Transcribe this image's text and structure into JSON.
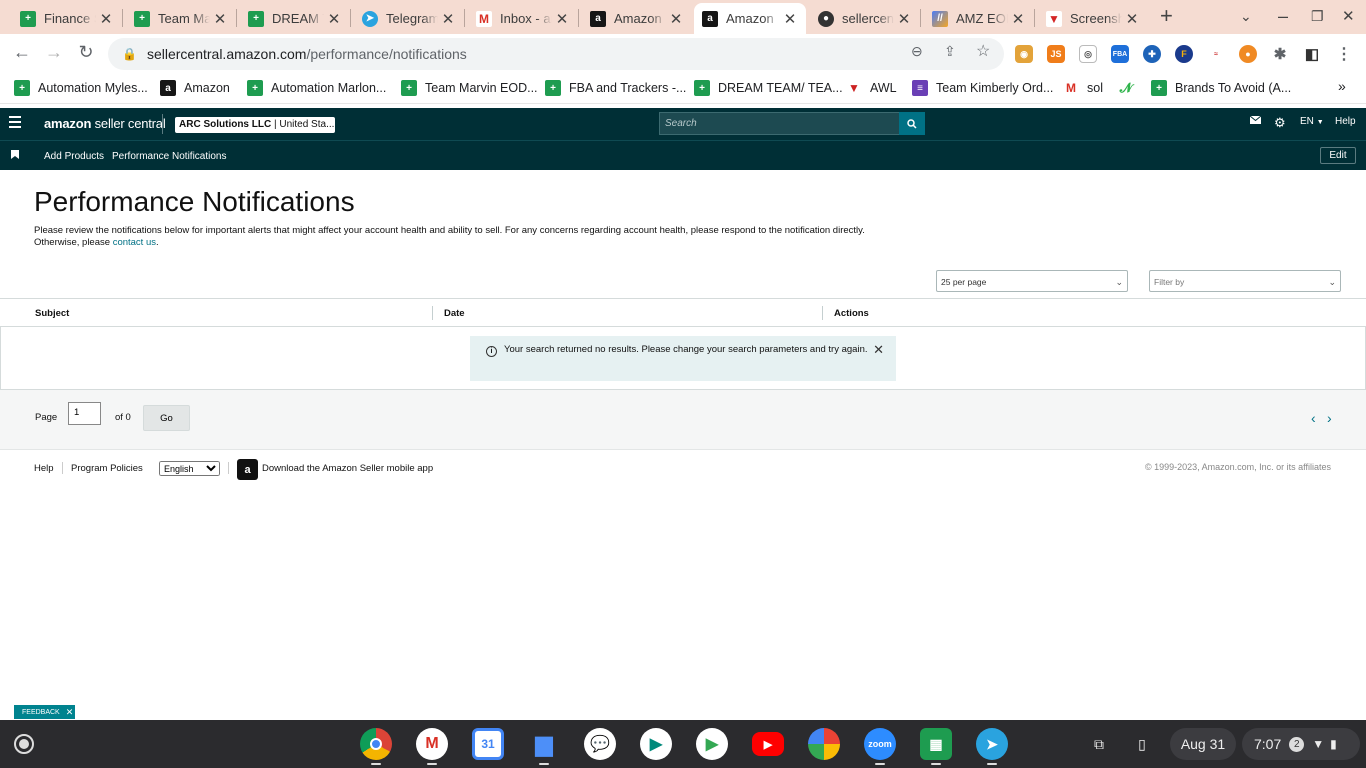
{
  "browser": {
    "tabs": [
      {
        "title": "Finance S",
        "icon": "sheets"
      },
      {
        "title": "Team Ma",
        "icon": "sheets"
      },
      {
        "title": "DREAM T",
        "icon": "sheets"
      },
      {
        "title": "Telegram",
        "icon": "telegram"
      },
      {
        "title": "Inbox - ar",
        "icon": "gmail"
      },
      {
        "title": "Amazon",
        "icon": "amazon"
      },
      {
        "title": "Amazon",
        "icon": "amazon",
        "active": true
      },
      {
        "title": "sellercent",
        "icon": "github"
      },
      {
        "title": "AMZ EOD",
        "icon": "amz-eod"
      },
      {
        "title": "Screensh",
        "icon": "screenshot"
      }
    ],
    "url_host": "sellercentral.amazon.com",
    "url_path": "/performance/notifications",
    "bookmarks": [
      "Automation Myles...",
      "Amazon",
      "Automation Marlon...",
      "Team Marvin EOD...",
      "FBA and Trackers -...",
      "DREAM TEAM/ TEA...",
      "AWL",
      "Team Kimberly Ord...",
      "sol",
      "",
      "Brands To Avoid (A..."
    ]
  },
  "header": {
    "logo_brand": "amazon",
    "logo_product": " seller central",
    "account_name": "ARC Solutions LLC",
    "account_region": " | United Sta...",
    "search_placeholder": "Search",
    "language": "EN",
    "help": "Help",
    "subnav": [
      "Add Products",
      "Performance Notifications"
    ],
    "edit": "Edit"
  },
  "page": {
    "title": "Performance Notifications",
    "description": "Please review the notifications below for important alerts that might affect your account health and ability to sell. For any concerns regarding account health, please respond to the notification directly. Otherwise, please ",
    "contact_link": "contact us",
    "description_end": ".",
    "per_page": "25 per page",
    "filter_placeholder": "Filter by",
    "columns": [
      "Subject",
      "Date",
      "Actions"
    ],
    "no_results": "Your search returned no results. Please change your search parameters and try again.",
    "pager": {
      "page_label": "Page",
      "current_page": "1",
      "of_label": "of 0",
      "go": "Go"
    }
  },
  "footer": {
    "help": "Help",
    "program_policies": "Program Policies",
    "language_option": "English",
    "app_download": "Download the Amazon Seller mobile app",
    "copyright": "© 1999-2023, Amazon.com, Inc. or its affiliates"
  },
  "feedback": {
    "label": "FEEDBACK"
  },
  "shelf": {
    "apps": [
      "Chrome",
      "Gmail",
      "Calendar",
      "Files",
      "Messages",
      "Meet",
      "Play Store",
      "YouTube",
      "Photos",
      "Zoom",
      "Sheets",
      "Telegram"
    ],
    "zoom_label": "zoom",
    "calendar_label": "31",
    "date": "Aug 31",
    "time": "7:07",
    "notification_count": "2"
  },
  "colors": {
    "sc_header": "#002f36",
    "link": "#007185",
    "tabstrip": "#f5dcd2"
  }
}
